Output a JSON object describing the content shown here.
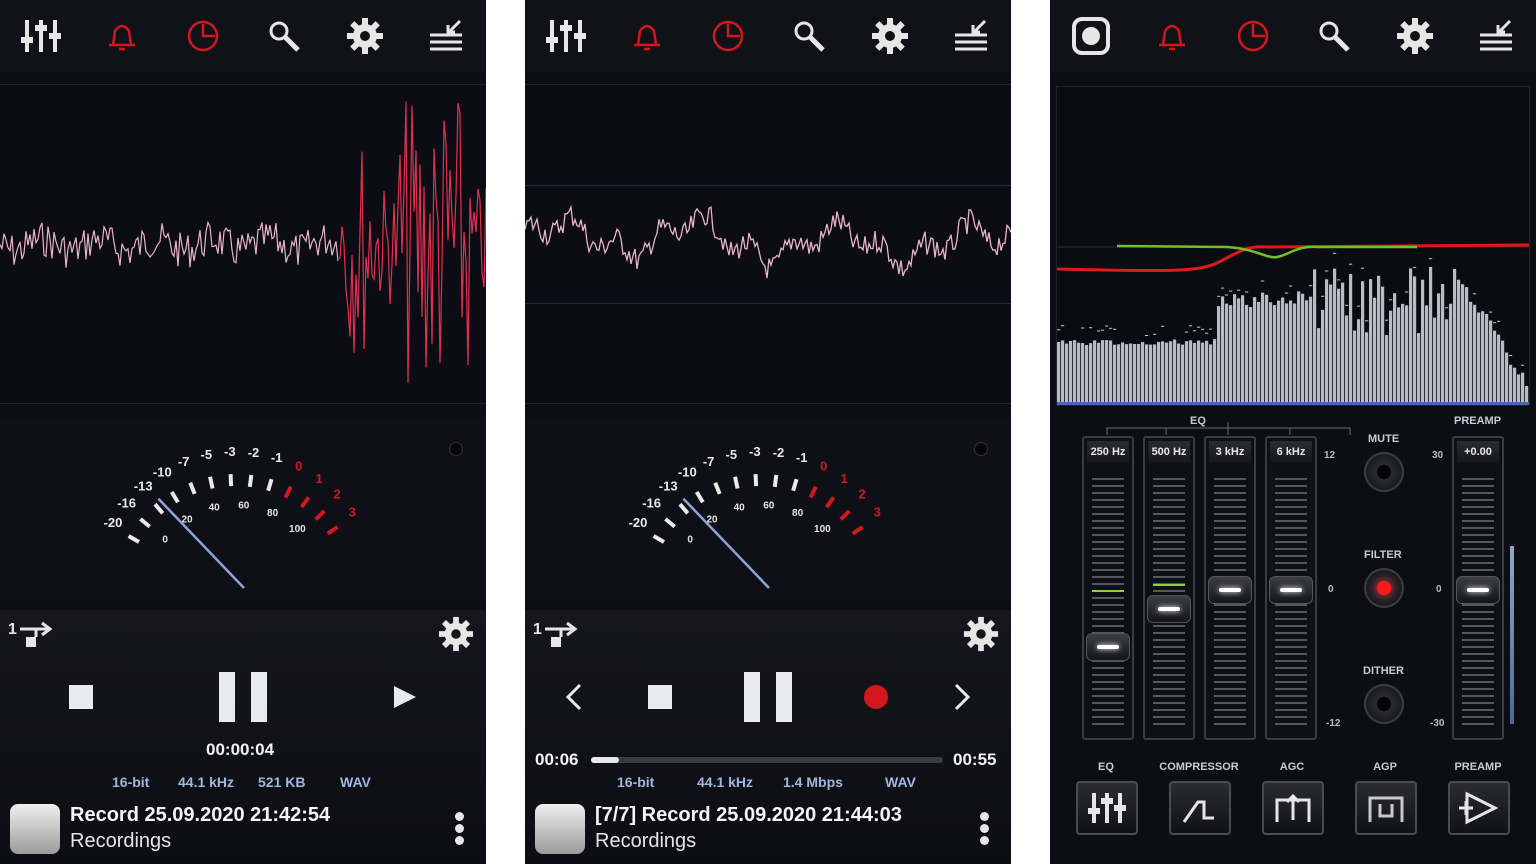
{
  "panel1": {
    "elapsed": "00:00:04",
    "meta": [
      "16-bit",
      "44.1 kHz",
      "521 KB",
      "WAV"
    ],
    "title": "Record 25.09.2020 21:42:54",
    "folder": "Recordings",
    "vu_scale_outer": [
      "-20",
      "-16",
      "-13",
      "-10",
      "-7",
      "-5",
      "-3",
      "-2",
      "-1",
      "0",
      "1",
      "2",
      "3"
    ],
    "vu_scale_inner": [
      "0",
      "20",
      "40",
      "60",
      "80",
      "100"
    ]
  },
  "panel2": {
    "position": "00:06",
    "duration": "00:55",
    "progress": 0.08,
    "meta": [
      "16-bit",
      "44.1 kHz",
      "1.4 Mbps",
      "WAV"
    ],
    "title": "[7/7] Record 25.09.2020 21:44:03",
    "folder": "Recordings",
    "vu_scale_outer": [
      "-20",
      "-16",
      "-13",
      "-10",
      "-7",
      "-5",
      "-3",
      "-2",
      "-1",
      "0",
      "1",
      "2",
      "3"
    ],
    "vu_scale_inner": [
      "0",
      "20",
      "40",
      "60",
      "80",
      "100"
    ]
  },
  "panel3": {
    "eq_label": "EQ",
    "preamp_label": "PREAMP",
    "bands": [
      "250 Hz",
      "500 Hz",
      "3 kHz",
      "6 kHz"
    ],
    "band_levels_db": [
      -3,
      -1,
      0,
      0
    ],
    "eq_scale": [
      "12",
      "0",
      "-12"
    ],
    "preamp_value": "+0.00",
    "preamp_scale": [
      "30",
      "0",
      "-30"
    ],
    "mute": "MUTE",
    "filter": "FILTER",
    "dither": "DITHER",
    "bottom": [
      "EQ",
      "COMPRESSOR",
      "AGC",
      "AGP",
      "PREAMP"
    ]
  },
  "toolbar_icons": [
    "mixer-icon",
    "bell-icon",
    "timer-icon",
    "search-icon",
    "gear-icon",
    "list-collapse-icon"
  ],
  "colors": {
    "accent_red": "#d2171e",
    "wave": "#e8b4c8",
    "wave_peak": "#e03050",
    "meta_blue": "#9eb8e0"
  }
}
